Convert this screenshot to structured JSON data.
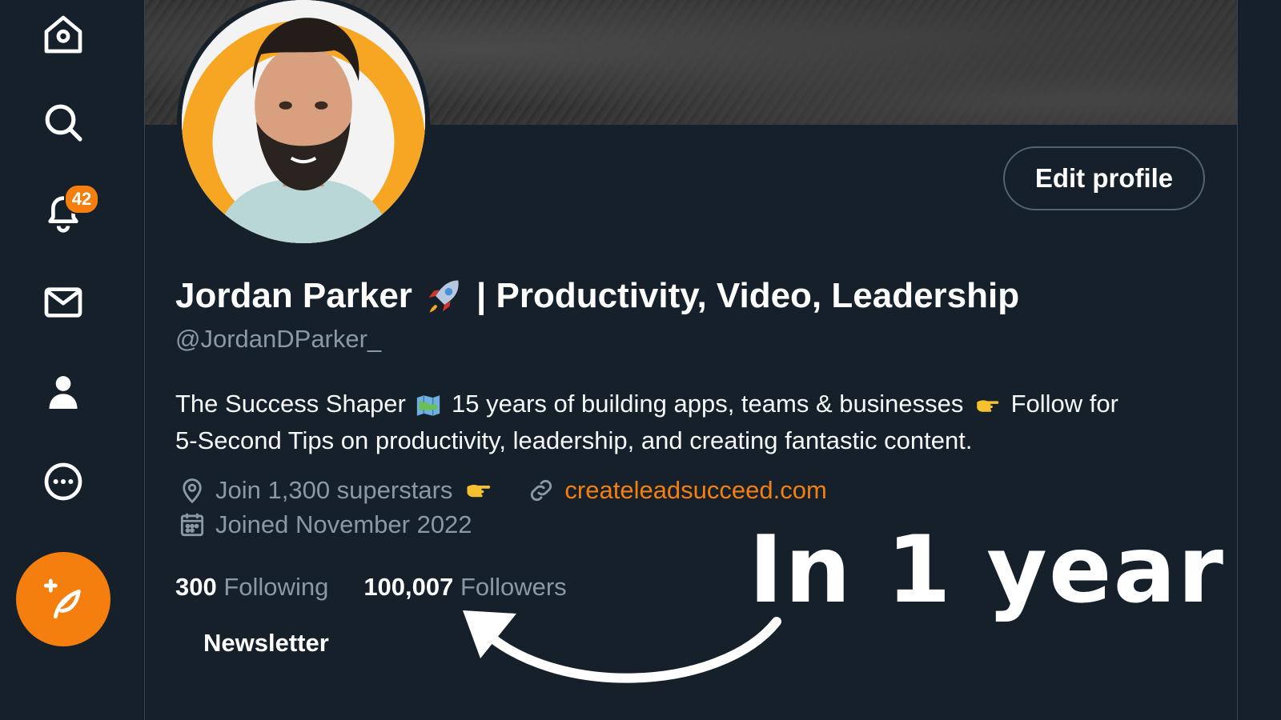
{
  "sidebar": {
    "items": [
      {
        "icon": "home-icon"
      },
      {
        "icon": "search-icon"
      },
      {
        "icon": "bell-icon"
      },
      {
        "icon": "mail-icon"
      },
      {
        "icon": "profile-icon"
      },
      {
        "icon": "more-icon"
      }
    ],
    "notification_count": "42",
    "compose_icon": "feather-plus-icon"
  },
  "profile": {
    "name": "Jordan Parker",
    "name_suffix": "| Productivity, Video, Leadership",
    "handle": "@JordanDParker_",
    "edit_label": "Edit profile",
    "bio_part1": "The Success Shaper",
    "bio_part2": "15 years of building apps, teams & businesses",
    "bio_part3": "Follow for",
    "bio_line2": "5-Second Tips on productivity, leadership, and creating fantastic content.",
    "location": "Join 1,300 superstars",
    "website": "createleadsucceed.com",
    "joined": "Joined November 2022",
    "following_count": "300",
    "following_label": "Following",
    "followers_count": "100,007",
    "followers_label": "Followers",
    "tab_newsletter": "Newsletter"
  },
  "overlay": {
    "caption": "In 1 year"
  },
  "colors": {
    "background": "#15202b",
    "accent": "#f47f0e",
    "muted": "#8b98a5"
  }
}
